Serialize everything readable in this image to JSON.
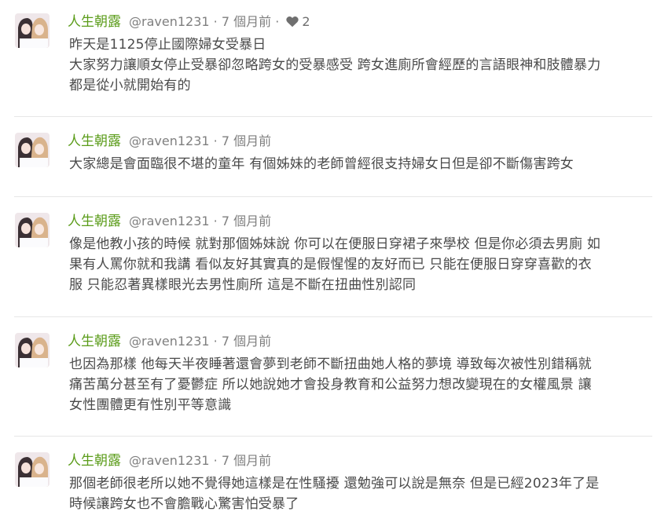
{
  "comments": [
    {
      "username": "人生朝露",
      "handle": "@raven1231",
      "separator": "·",
      "time": "7 個月前",
      "likes": "2",
      "avatar_icon": "anime-avatar",
      "lines": [
        "昨天是1125停止國際婦女受暴日",
        "大家努力讓順女停止受暴卻忽略跨女的受暴感受 跨女進廁所會經歷的言語眼神和肢體暴力",
        "都是從小就開始有的"
      ]
    },
    {
      "username": "人生朝露",
      "handle": "@raven1231",
      "separator": "·",
      "time": "7 個月前",
      "avatar_icon": "anime-avatar",
      "lines": [
        "大家總是會面臨很不堪的童年 有個姊妹的老師曾經很支持婦女日但是卻不斷傷害跨女"
      ]
    },
    {
      "username": "人生朝露",
      "handle": "@raven1231",
      "separator": "·",
      "time": "7 個月前",
      "avatar_icon": "anime-avatar",
      "lines": [
        "像是他教小孩的時候 就對那個姊妹說 你可以在便服日穿裙子來學校 但是你必須去男廁 如",
        "果有人罵你就和我講 看似友好其實真的是假惺惺的友好而已 只能在便服日穿穿喜歡的衣",
        "服 只能忍著異樣眼光去男性廁所 這是不斷在扭曲性別認同"
      ]
    },
    {
      "username": "人生朝露",
      "handle": "@raven1231",
      "separator": "·",
      "time": "7 個月前",
      "avatar_icon": "anime-avatar",
      "lines": [
        "也因為那樣 他每天半夜睡著還會夢到老師不斷扭曲她人格的夢境 導致每次被性別錯稱就",
        "痛苦萬分甚至有了憂鬱症 所以她說她才會投身教育和公益努力想改變現在的女權風景 讓",
        "女性團體更有性別平等意識"
      ]
    },
    {
      "username": "人生朝露",
      "handle": "@raven1231",
      "separator": "·",
      "time": "7 個月前",
      "avatar_icon": "anime-avatar",
      "lines": [
        "那個老師很老所以她不覺得她這樣是在性騷擾 還勉強可以說是無奈 但是已經2023年了是",
        "時候讓跨女也不會膽戰心驚害怕受暴了"
      ]
    }
  ],
  "colors": {
    "username": "#5b9c1a",
    "meta": "#7f7f7f",
    "body": "#4a4a4a",
    "divider": "#e6e6e6",
    "heart": "#6f6f6f"
  }
}
